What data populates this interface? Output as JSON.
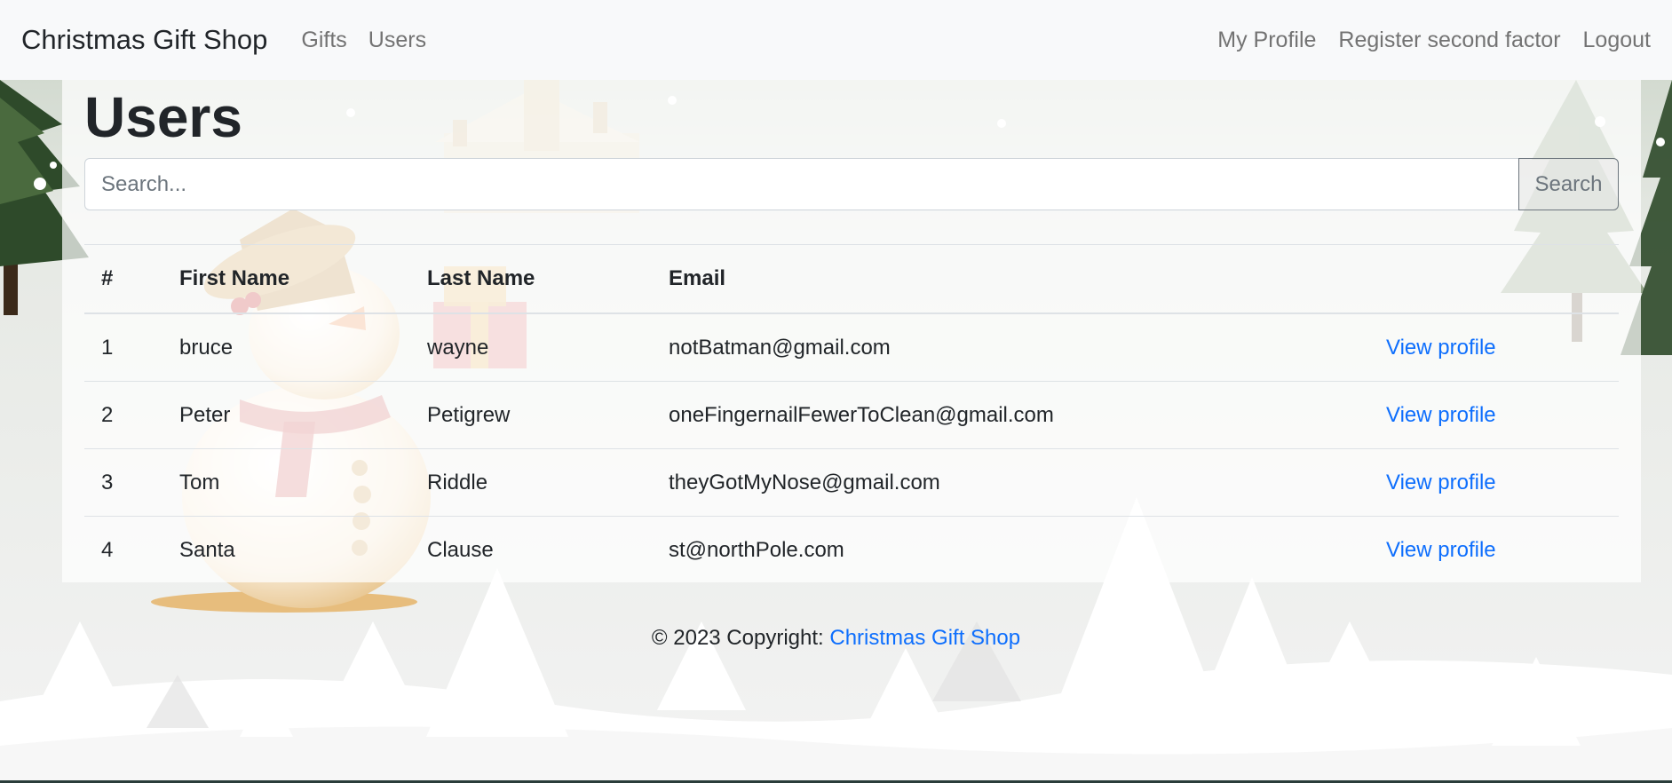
{
  "navbar": {
    "brand": "Christmas Gift Shop",
    "links": [
      "Gifts",
      "Users"
    ],
    "right_links": [
      "My Profile",
      "Register second factor",
      "Logout"
    ]
  },
  "page": {
    "title": "Users"
  },
  "search": {
    "placeholder": "Search...",
    "button_label": "Search"
  },
  "table": {
    "headers": [
      "#",
      "First Name",
      "Last Name",
      "Email"
    ],
    "rows": [
      {
        "num": "1",
        "first": "bruce",
        "last": "wayne",
        "email": "notBatman@gmail.com",
        "action": "View profile"
      },
      {
        "num": "2",
        "first": "Peter",
        "last": "Petigrew",
        "email": "oneFingernailFewerToClean@gmail.com",
        "action": "View profile"
      },
      {
        "num": "3",
        "first": "Tom",
        "last": "Riddle",
        "email": "theyGotMyNose@gmail.com",
        "action": "View profile"
      },
      {
        "num": "4",
        "first": "Santa",
        "last": "Clause",
        "email": "st@northPole.com",
        "action": "View profile"
      }
    ]
  },
  "footer": {
    "copyright": "© 2023 Copyright:",
    "link": "Christmas Gift Shop"
  },
  "colors": {
    "link": "#0d6efd",
    "navbar_bg": "#f8f9fa",
    "nav_text": "#737373"
  }
}
